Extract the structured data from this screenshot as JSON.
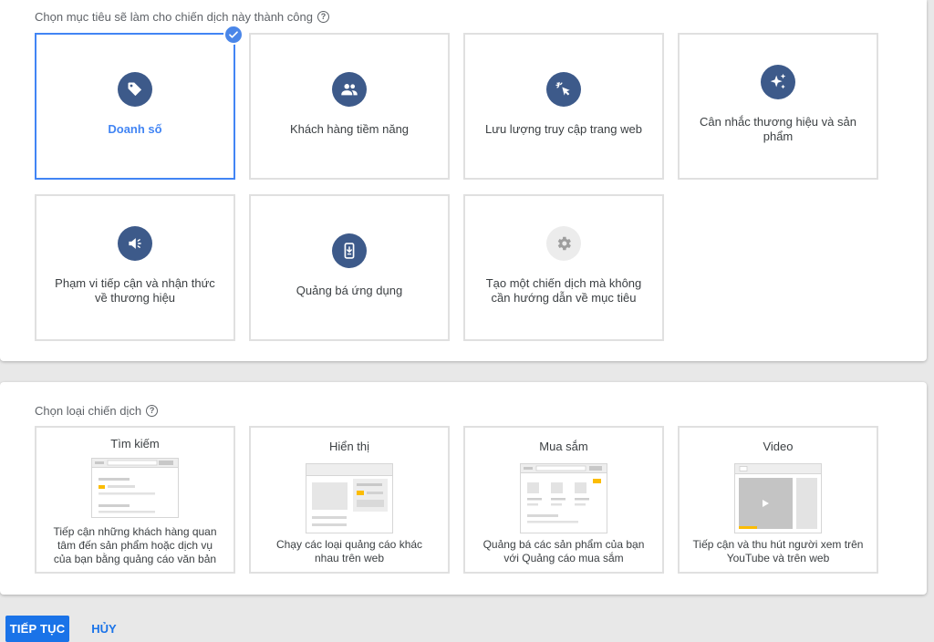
{
  "goal_section": {
    "title": "Chọn mục tiêu sẽ làm cho chiến dịch này thành công",
    "help_icon": "?",
    "goals": [
      {
        "label": "Doanh số",
        "icon": "tag-icon",
        "selected": true
      },
      {
        "label": "Khách hàng tiềm năng",
        "icon": "people-icon",
        "selected": false
      },
      {
        "label": "Lưu lượng truy cập trang web",
        "icon": "cursor-click-icon",
        "selected": false
      },
      {
        "label": "Cân nhắc thương hiệu và sản phẩm",
        "icon": "sparkle-icon",
        "selected": false
      },
      {
        "label": "Phạm vi tiếp cận và nhận thức về thương hiệu",
        "icon": "megaphone-icon",
        "selected": false
      },
      {
        "label": "Quảng bá ứng dụng",
        "icon": "phone-download-icon",
        "selected": false
      },
      {
        "label": "Tạo một chiến dịch mà không cần hướng dẫn về mục tiêu",
        "icon": "gear-icon",
        "selected": false
      }
    ]
  },
  "type_section": {
    "title": "Chọn loại chiến dịch",
    "help_icon": "?",
    "types": [
      {
        "title": "Tìm kiếm",
        "description": "Tiếp cận những khách hàng quan tâm đến sản phẩm hoặc dịch vụ của bạn bằng quảng cáo văn bản"
      },
      {
        "title": "Hiển thị",
        "description": "Chạy các loại quảng cáo khác nhau trên web"
      },
      {
        "title": "Mua sắm",
        "description": "Quảng bá các sản phẩm của bạn với Quảng cáo mua sắm"
      },
      {
        "title": "Video",
        "description": "Tiếp cận và thu hút người xem trên YouTube và trên web"
      }
    ]
  },
  "actions": {
    "continue_label": "TIẾP TỤC",
    "cancel_label": "HỦY"
  },
  "colors": {
    "accent": "#1a73e8",
    "selected_border": "#4285f4",
    "icon_bg": "#3d5a8a",
    "illus_accent": "#fbbc04"
  }
}
